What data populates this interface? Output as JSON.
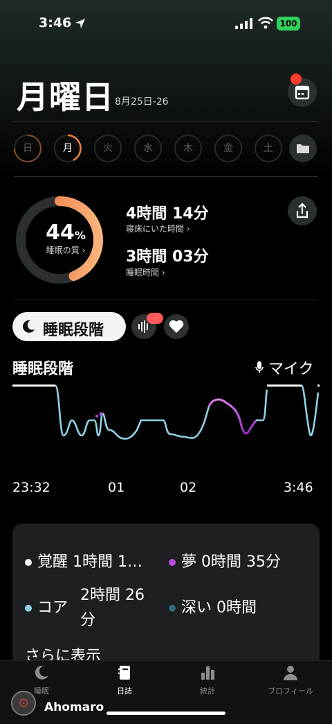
{
  "status": {
    "time": "3:46",
    "battery": "100"
  },
  "header": {
    "title": "月曜日",
    "date_range": "8月25日-26"
  },
  "days": [
    "日",
    "月",
    "火",
    "水",
    "木",
    "金",
    "土"
  ],
  "summary": {
    "quality_pct": "44",
    "quality_unit": "%",
    "quality_label": "睡眠の質 ›",
    "quality_value": 0.44,
    "in_bed_value": "4時間 14分",
    "in_bed_label": "寝床にいた時間 ›",
    "asleep_value": "3時間 03分",
    "asleep_label": "睡眠時間 ›"
  },
  "chips": {
    "main": "睡眠段階"
  },
  "chart": {
    "title": "睡眠段階",
    "mic_label": "マイク",
    "x_ticks": [
      "23:32",
      "01",
      "02",
      "3:46"
    ]
  },
  "legend": {
    "awake": "覚醒  1時間 1…",
    "dream": "夢  0時間 35分",
    "core_name": "コア",
    "core_value": "2時間 26",
    "core_value_2": "分",
    "deep": "深い  0時間",
    "more": "さらに表示"
  },
  "colors": {
    "awake": "#ffffff",
    "dream": "#c04ae0",
    "core": "#8fd3e6",
    "deep": "#2f6e78",
    "accent": "#f0823c"
  },
  "tabs": [
    {
      "label": "睡眠",
      "icon": "moon-icon"
    },
    {
      "label": "日誌",
      "icon": "journal-icon"
    },
    {
      "label": "統計",
      "icon": "bar-chart-icon"
    },
    {
      "label": "プロフィール",
      "icon": "person-icon"
    }
  ],
  "watermark": {
    "name": "Ahomaro"
  }
}
